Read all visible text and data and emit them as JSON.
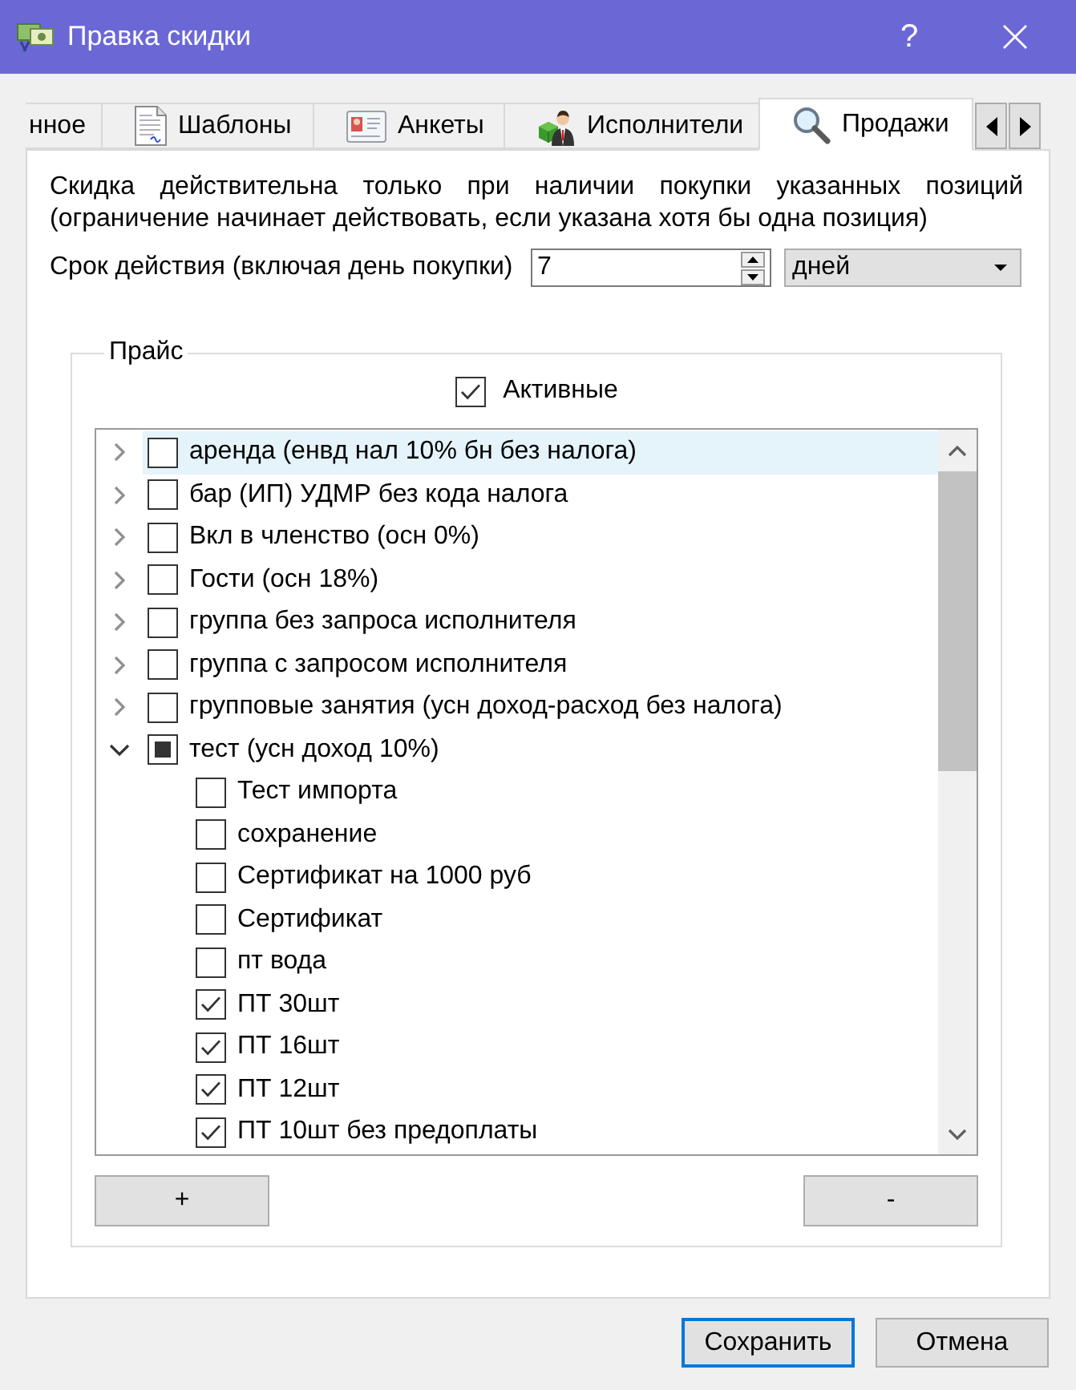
{
  "window": {
    "title": "Правка скидки",
    "help_label": "?"
  },
  "tabs": [
    {
      "label": "нное",
      "selected": false
    },
    {
      "label": "Шаблоны",
      "selected": false
    },
    {
      "label": "Анкеты",
      "selected": false
    },
    {
      "label": "Исполнители",
      "selected": false
    },
    {
      "label": "Продажи",
      "selected": true
    }
  ],
  "description": "Скидка действительна только при наличии покупки указанных позиций (ограничение начинает действовать, если указана хотя бы одна позиция)",
  "validity": {
    "label": "Срок действия (включая день покупки)",
    "value": "7",
    "unit": "дней"
  },
  "price_list": {
    "title": "Прайс",
    "active_filter": {
      "label": "Активные",
      "checked": true
    },
    "tree": [
      {
        "label": "аренда (енвд нал 10% бн без налога)",
        "expanded": false,
        "checked": false,
        "indeterminate": false,
        "selected": true
      },
      {
        "label": "бар (ИП) УДМР без кода налога",
        "expanded": false,
        "checked": false,
        "indeterminate": false,
        "selected": false
      },
      {
        "label": "Вкл в членство (осн 0%)",
        "expanded": false,
        "checked": false,
        "indeterminate": false,
        "selected": false
      },
      {
        "label": "Гости (осн 18%)",
        "expanded": false,
        "checked": false,
        "indeterminate": false,
        "selected": false
      },
      {
        "label": "группа без запроса исполнителя",
        "expanded": false,
        "checked": false,
        "indeterminate": false,
        "selected": false
      },
      {
        "label": "группа с запросом исполнителя",
        "expanded": false,
        "checked": false,
        "indeterminate": false,
        "selected": false
      },
      {
        "label": "групповые занятия (усн доход-расход без налога)",
        "expanded": false,
        "checked": false,
        "indeterminate": false,
        "selected": false
      },
      {
        "label": "тест (усн доход 10%)",
        "expanded": true,
        "checked": false,
        "indeterminate": true,
        "selected": false,
        "children": [
          {
            "label": "Тест импорта",
            "checked": false,
            "selected": false
          },
          {
            "label": "сохранение",
            "checked": false,
            "selected": false
          },
          {
            "label": "Сертификат на 1000 руб",
            "checked": false,
            "selected": false
          },
          {
            "label": "Сертификат",
            "checked": false,
            "selected": false
          },
          {
            "label": "пт вода",
            "checked": false,
            "selected": false
          },
          {
            "label": "ПТ 30шт",
            "checked": true,
            "selected": false
          },
          {
            "label": "ПТ 16шт",
            "checked": true,
            "selected": false
          },
          {
            "label": "ПТ 12шт",
            "checked": true,
            "selected": false
          },
          {
            "label": "ПТ 10шт без предоплаты",
            "checked": true,
            "selected": false
          }
        ]
      }
    ],
    "add_button": "+",
    "remove_button": "-"
  },
  "buttons": [
    {
      "label": "Сохранить",
      "default": true
    },
    {
      "label": "Отмена",
      "default": false
    }
  ]
}
